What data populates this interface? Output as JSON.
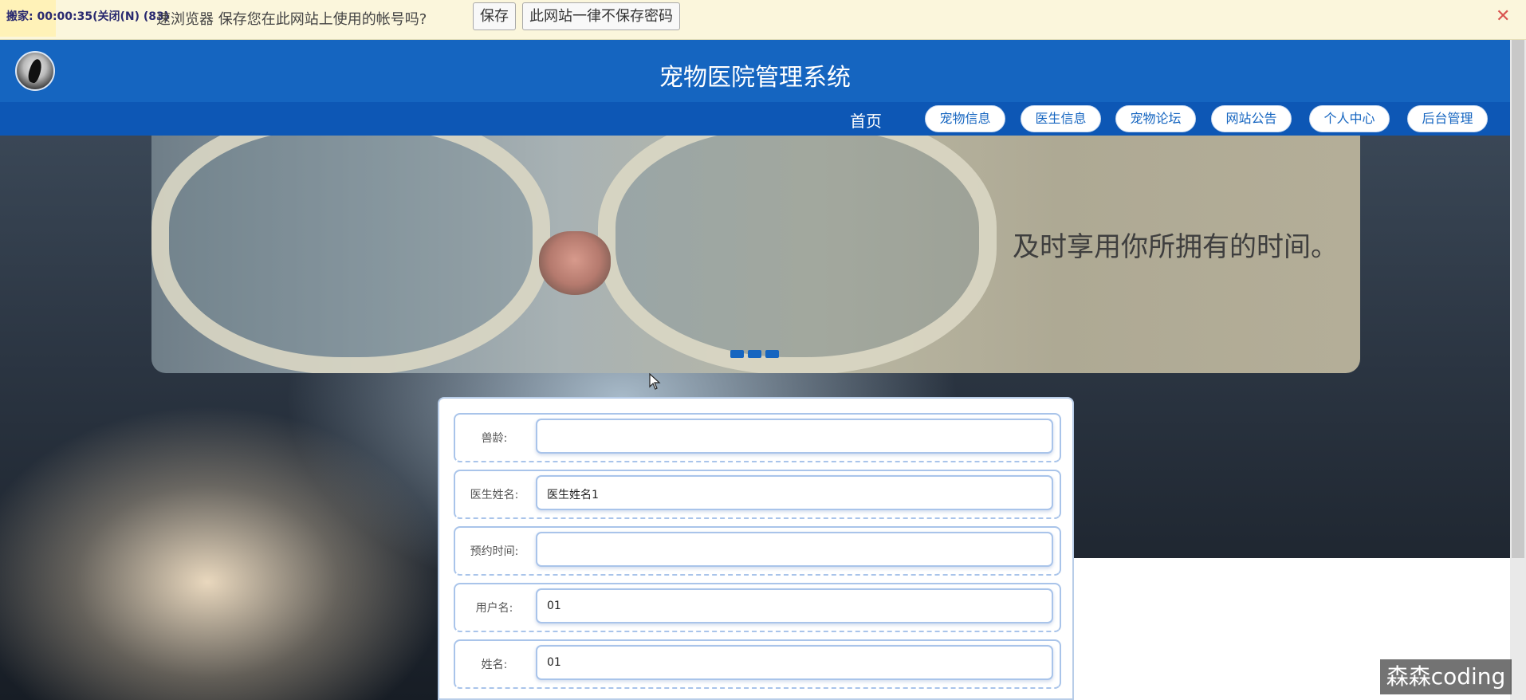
{
  "password_bar": {
    "recording_text": "搬家: 00:00:35(关闭(N) (83)",
    "message": "速浏览器 保存您在此网站上使用的帐号吗?",
    "save_label": "保存",
    "never_label": "此网站一律不保存密码",
    "close_glyph": "✕"
  },
  "header": {
    "title": "宠物医院管理系统"
  },
  "nav": {
    "home": "首页",
    "items": [
      "宠物信息",
      "医生信息",
      "宠物论坛",
      "网站公告",
      "个人中心",
      "后台管理"
    ]
  },
  "banner": {
    "slogan": "及时享用你所拥有的时间。",
    "slide_count": 3
  },
  "form": {
    "fields": [
      {
        "label": "兽龄:",
        "value": ""
      },
      {
        "label": "医生姓名:",
        "value": "医生姓名1"
      },
      {
        "label": "预约时间:",
        "value": ""
      },
      {
        "label": "用户名:",
        "value": "01"
      },
      {
        "label": "姓名:",
        "value": "01"
      }
    ]
  },
  "watermark": "森森coding",
  "colors": {
    "header_blue": "#1565c0",
    "nav_blue": "#0d57b5",
    "field_border": "#a9c4ea"
  }
}
